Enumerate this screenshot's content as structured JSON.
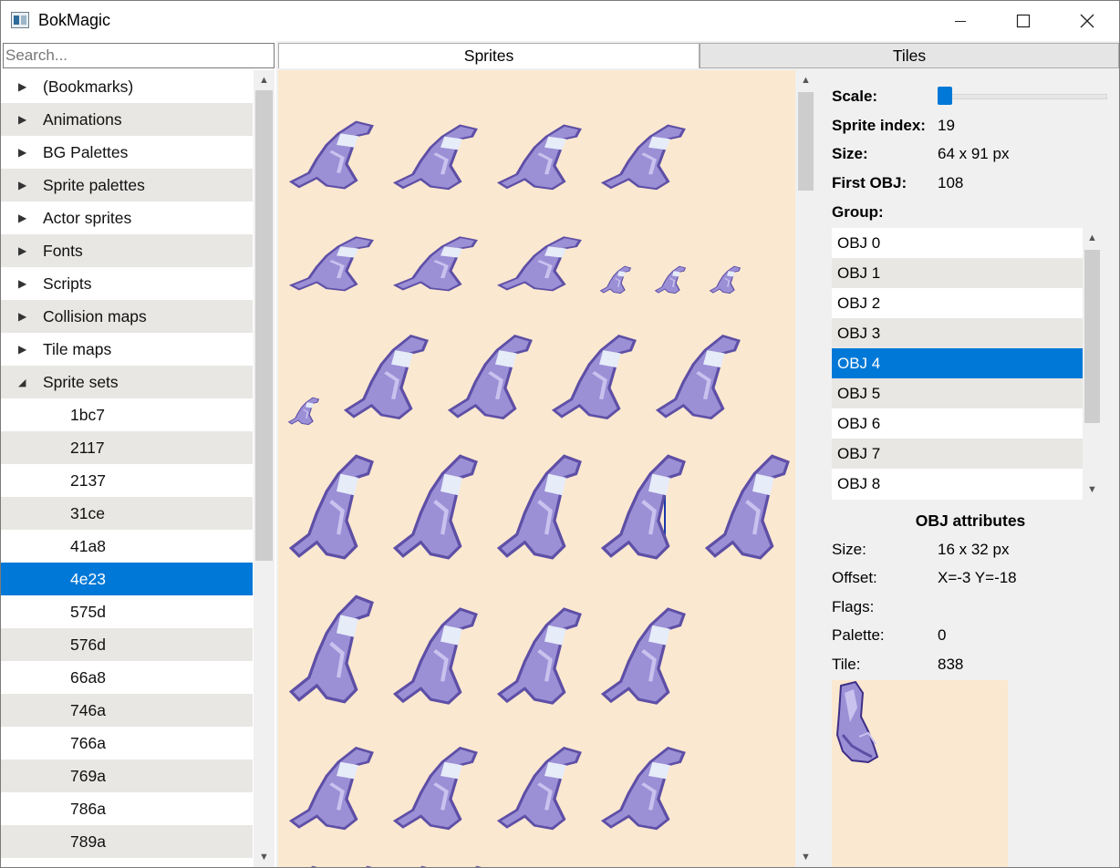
{
  "window": {
    "title": "BokMagic"
  },
  "search": {
    "placeholder": "Search..."
  },
  "tree": {
    "items": [
      {
        "label": "(Bookmarks)",
        "level": 0,
        "expanded": false
      },
      {
        "label": "Animations",
        "level": 0,
        "expanded": false
      },
      {
        "label": "BG Palettes",
        "level": 0,
        "expanded": false
      },
      {
        "label": "Sprite palettes",
        "level": 0,
        "expanded": false
      },
      {
        "label": "Actor sprites",
        "level": 0,
        "expanded": false
      },
      {
        "label": "Fonts",
        "level": 0,
        "expanded": false
      },
      {
        "label": "Scripts",
        "level": 0,
        "expanded": false
      },
      {
        "label": "Collision maps",
        "level": 0,
        "expanded": false
      },
      {
        "label": "Tile maps",
        "level": 0,
        "expanded": false
      },
      {
        "label": "Sprite sets",
        "level": 0,
        "expanded": true
      },
      {
        "label": "1bc7",
        "level": 1
      },
      {
        "label": "2117",
        "level": 1
      },
      {
        "label": "2137",
        "level": 1
      },
      {
        "label": "31ce",
        "level": 1
      },
      {
        "label": "41a8",
        "level": 1
      },
      {
        "label": "4e23",
        "level": 1,
        "selected": true
      },
      {
        "label": "575d",
        "level": 1
      },
      {
        "label": "576d",
        "level": 1
      },
      {
        "label": "66a8",
        "level": 1
      },
      {
        "label": "746a",
        "level": 1
      },
      {
        "label": "766a",
        "level": 1
      },
      {
        "label": "769a",
        "level": 1
      },
      {
        "label": "786a",
        "level": 1
      },
      {
        "label": "789a",
        "level": 1
      }
    ]
  },
  "tabs": [
    {
      "label": "Sprites",
      "active": true
    },
    {
      "label": "Tiles",
      "active": false
    }
  ],
  "details": {
    "scale_label": "Scale:",
    "scale_value": 0.0,
    "sprite_index_label": "Sprite index:",
    "sprite_index": "19",
    "size_label": "Size:",
    "size": "64 x 91 px",
    "first_obj_label": "First OBJ:",
    "first_obj": "108",
    "group_label": "Group:"
  },
  "group_list": {
    "items": [
      "OBJ 0",
      "OBJ 1",
      "OBJ 2",
      "OBJ 3",
      "OBJ 4",
      "OBJ 5",
      "OBJ 6",
      "OBJ 7",
      "OBJ 8"
    ],
    "selected_index": 4
  },
  "obj_attributes": {
    "title": "OBJ attributes",
    "size_label": "Size:",
    "size": "16 x 32 px",
    "offset_label": "Offset:",
    "offset": "X=-3 Y=-18",
    "flags_label": "Flags:",
    "flags": "",
    "palette_label": "Palette:",
    "palette": "0",
    "tile_label": "Tile:",
    "tile": "838"
  },
  "colors": {
    "accent": "#0078d7",
    "canvas_bg": "#fbe8d0",
    "sprite_body": "#9b8fd6",
    "sprite_shade": "#5e4fa6",
    "sprite_light": "#c9c2ee",
    "sprite_fur": "#e6ecf8"
  },
  "sprite_grid": [
    [
      0.71,
      0.68,
      0.68,
      0.68
    ],
    [
      0.7,
      0.7,
      0.7,
      0.3,
      0.3,
      0.3
    ],
    [
      0.3,
      0.8,
      0.8,
      0.8,
      0.8
    ],
    [
      0.92,
      0.92,
      0.92,
      0.92,
      0.92
    ],
    [
      0.95,
      0.85,
      0.85,
      0.85
    ],
    [
      0.85,
      0.85,
      0.85,
      0.85
    ],
    [
      0.2,
      0.2,
      0.2,
      0.2
    ]
  ]
}
